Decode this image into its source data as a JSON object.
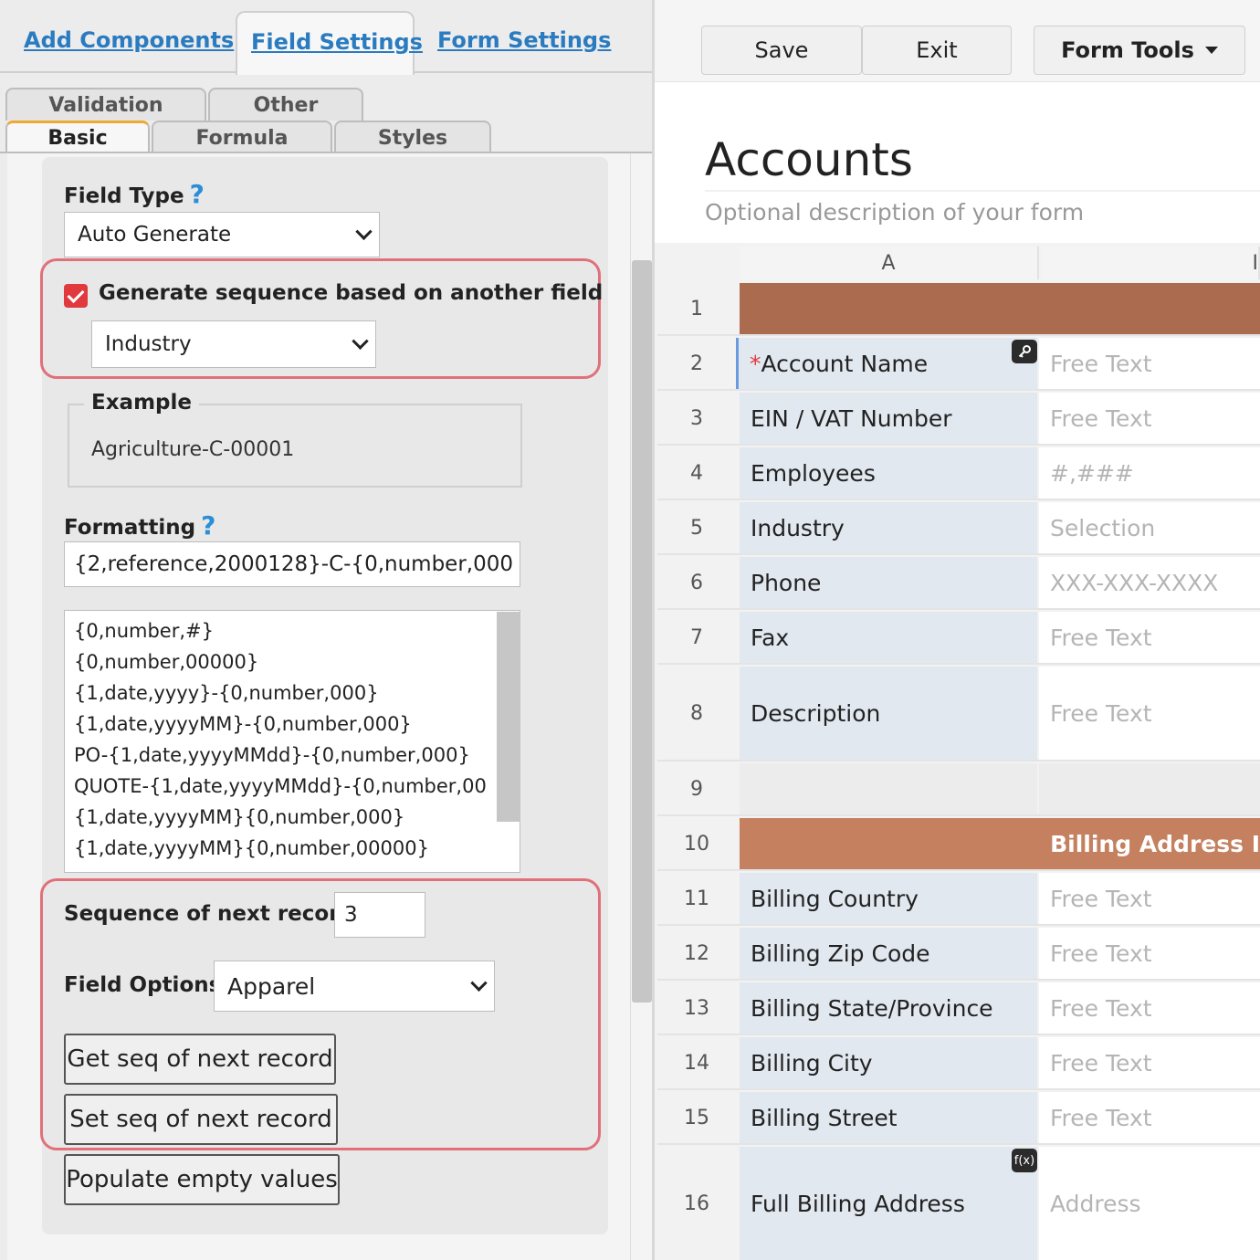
{
  "top_tabs": {
    "add_components": "Add Components",
    "field_settings": "Field Settings",
    "form_settings": "Form Settings"
  },
  "sub_tabs": {
    "validation": "Validation",
    "other": "Other",
    "basic": "Basic",
    "formula": "Formula",
    "styles": "Styles"
  },
  "field_type": {
    "label": "Field Type",
    "help": "?",
    "value": "Auto Generate"
  },
  "sequence_based": {
    "checked": true,
    "label": "Generate sequence based on another field",
    "field": "Industry"
  },
  "example": {
    "legend": "Example",
    "value": "Agriculture-C-00001"
  },
  "formatting": {
    "label": "Formatting",
    "help": "?",
    "value": "{2,reference,2000128}-C-{0,number,000",
    "presets": [
      "{0,number,#}",
      "{0,number,00000}",
      "{1,date,yyyy}-{0,number,000}",
      "{1,date,yyyyMM}-{0,number,000}",
      "PO-{1,date,yyyyMMdd}-{0,number,000}",
      "QUOTE-{1,date,yyyyMMdd}-{0,number,00",
      "{1,date,yyyyMM}{0,number,000}",
      "{1,date,yyyyMM}{0,number,00000}"
    ]
  },
  "next_record": {
    "label": "Sequence of next record",
    "value": "3",
    "field_options_label": "Field Options",
    "field_option": "Apparel",
    "get_button": "Get seq of next record",
    "set_button": "Set seq of next record",
    "populate_button": "Populate empty values"
  },
  "toolbar": {
    "save": "Save",
    "exit": "Exit",
    "form_tools": "Form Tools"
  },
  "form": {
    "title": "Accounts",
    "description": "Optional description of your form",
    "columns": [
      "A",
      "I"
    ],
    "rows": [
      {
        "num": "1",
        "type": "section",
        "label": ""
      },
      {
        "num": "2",
        "type": "field",
        "required": "*",
        "label": "Account Name",
        "placeholder": "Free Text",
        "badge": "key"
      },
      {
        "num": "3",
        "type": "field",
        "label": "EIN / VAT Number",
        "placeholder": "Free Text"
      },
      {
        "num": "4",
        "type": "field",
        "label": "Employees",
        "placeholder": "#,###"
      },
      {
        "num": "5",
        "type": "field",
        "label": "Industry",
        "placeholder": "Selection"
      },
      {
        "num": "6",
        "type": "field",
        "label": "Phone",
        "placeholder": "XXX-XXX-XXXX"
      },
      {
        "num": "7",
        "type": "field",
        "label": "Fax",
        "placeholder": "Free Text"
      },
      {
        "num": "8",
        "type": "field",
        "label": "Description",
        "placeholder": "Free Text"
      },
      {
        "num": "9",
        "type": "empty",
        "label": ""
      },
      {
        "num": "10",
        "type": "section",
        "label": "Billing Address I"
      },
      {
        "num": "11",
        "type": "field",
        "label": "Billing Country",
        "placeholder": "Free Text"
      },
      {
        "num": "12",
        "type": "field",
        "label": "Billing Zip Code",
        "placeholder": "Free Text"
      },
      {
        "num": "13",
        "type": "field",
        "label": "Billing State/Province",
        "placeholder": "Free Text"
      },
      {
        "num": "14",
        "type": "field",
        "label": "Billing City",
        "placeholder": "Free Text"
      },
      {
        "num": "15",
        "type": "field",
        "label": "Billing Street",
        "placeholder": "Free Text"
      },
      {
        "num": "16",
        "type": "field",
        "label": "Full Billing Address",
        "placeholder": "Address",
        "badge": "f(x)"
      }
    ]
  },
  "colors": {
    "section_dark": "#ab6b4f",
    "section_light": "#c4805f",
    "link": "#2a7bc0",
    "highlight": "#e0707a",
    "checkbox": "#e0393e"
  }
}
